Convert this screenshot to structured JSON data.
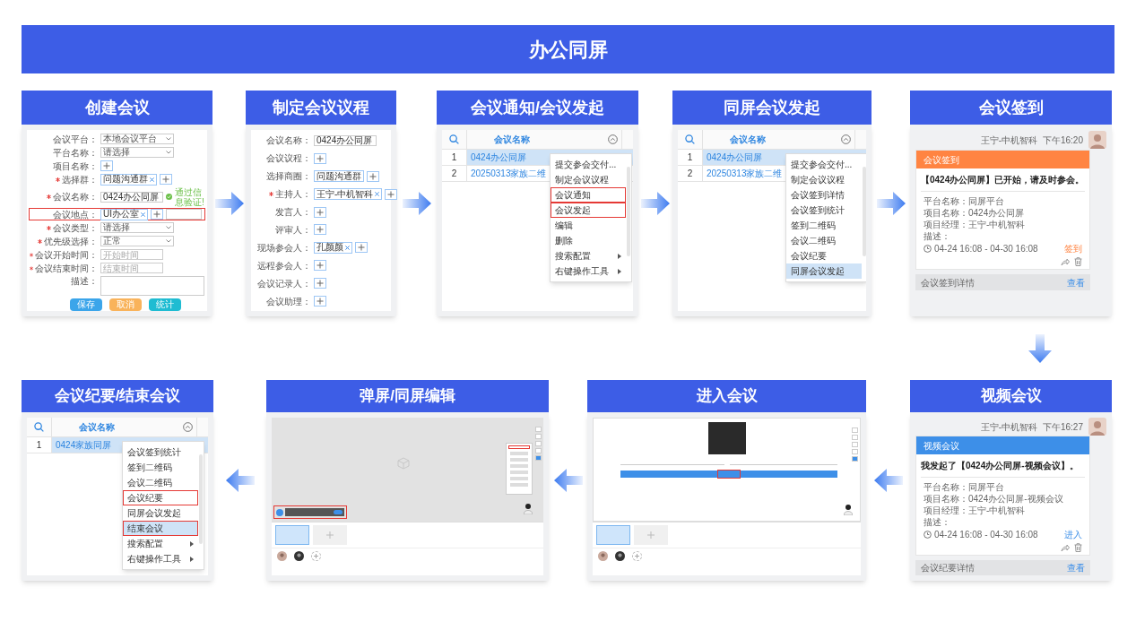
{
  "title": "办公同屏",
  "top_row": [
    {
      "title": "创建会议",
      "kind": "form",
      "fields": [
        {
          "label": "会议平台：",
          "required": false,
          "highlighted": false,
          "kind": "select",
          "value": "本地会议平台"
        },
        {
          "label": "平台名称：",
          "required": false,
          "highlighted": false,
          "kind": "select",
          "value": "请选择"
        },
        {
          "label": "项目名称：",
          "required": false,
          "highlighted": false,
          "kind": "add"
        },
        {
          "label": "选择群：",
          "required": true,
          "highlighted": false,
          "kind": "tags",
          "tags": [
            {
              "text": "问题沟通群",
              "removable": true
            }
          ]
        },
        {
          "label": "会议名称：",
          "required": true,
          "highlighted": false,
          "kind": "input",
          "value": "0424办公同屏",
          "hint": "通过信息验证!"
        },
        {
          "label": "会议地点：",
          "required": false,
          "highlighted": true,
          "kind": "tags_input",
          "tags": [
            {
              "text": "UI办公室",
              "removable": true
            }
          ]
        },
        {
          "label": "会议类型：",
          "required": true,
          "highlighted": false,
          "kind": "select",
          "value": "请选择"
        },
        {
          "label": "优先级选择：",
          "required": true,
          "highlighted": false,
          "kind": "select",
          "value": "正常"
        },
        {
          "label": "会议开始时间：",
          "required": true,
          "highlighted": false,
          "kind": "input",
          "placeholder": "开始时间"
        },
        {
          "label": "会议结束时间：",
          "required": true,
          "highlighted": false,
          "kind": "input",
          "placeholder": "结束时间"
        },
        {
          "label": "描述：",
          "required": false,
          "highlighted": false,
          "kind": "textarea"
        }
      ],
      "buttons": [
        {
          "label": "保存",
          "color": "#3ba5ea"
        },
        {
          "label": "取消",
          "color": "#f9b35b"
        },
        {
          "label": "统计",
          "color": "#1fbcd2"
        }
      ]
    },
    {
      "title": "制定会议议程",
      "kind": "form",
      "fields": [
        {
          "label": "会议名称：",
          "required": false,
          "highlighted": false,
          "kind": "input",
          "value": "0424办公同屏"
        },
        {
          "label": "会议议程：",
          "required": false,
          "highlighted": false,
          "kind": "add"
        },
        {
          "label": "选择商圈：",
          "required": false,
          "highlighted": false,
          "kind": "tags",
          "tags": [
            {
              "text": "问题沟通群",
              "removable": false
            }
          ]
        },
        {
          "label": "主持人：",
          "required": true,
          "highlighted": false,
          "kind": "tags",
          "tags": [
            {
              "text": "王宁-中机智科",
              "removable": true
            }
          ]
        },
        {
          "label": "发言人：",
          "required": false,
          "highlighted": false,
          "kind": "add"
        },
        {
          "label": "评审人：",
          "required": false,
          "highlighted": false,
          "kind": "add"
        },
        {
          "label": "现场参会人：",
          "required": false,
          "highlighted": false,
          "kind": "tags",
          "tags": [
            {
              "text": "孔颜颜",
              "removable": true
            }
          ]
        },
        {
          "label": "远程参会人：",
          "required": false,
          "highlighted": false,
          "kind": "add"
        },
        {
          "label": "会议记录人：",
          "required": false,
          "highlighted": false,
          "kind": "add"
        },
        {
          "label": "会议助理：",
          "required": false,
          "highlighted": false,
          "kind": "add"
        }
      ]
    },
    {
      "title": "会议通知/会议发起",
      "kind": "table_menu",
      "column": "会议名称",
      "rows": [
        {
          "number": "1",
          "name": "0424办公同屏",
          "selected": true
        },
        {
          "number": "2",
          "name": "20250313家族二维",
          "selected": false
        }
      ],
      "menu": [
        {
          "text": "提交参会交付...",
          "submenu": false,
          "highlighted": false,
          "selected": false
        },
        {
          "text": "制定会议议程",
          "submenu": false,
          "highlighted": false,
          "selected": false
        },
        {
          "text": "会议通知",
          "submenu": false,
          "highlighted": true,
          "selected": false
        },
        {
          "text": "会议发起",
          "submenu": false,
          "highlighted": true,
          "selected": false
        },
        {
          "text": "编辑",
          "submenu": false,
          "highlighted": false,
          "selected": false
        },
        {
          "text": "删除",
          "submenu": false,
          "highlighted": false,
          "selected": false
        },
        {
          "text": "搜索配置",
          "submenu": true,
          "highlighted": false,
          "selected": false
        },
        {
          "text": "右键操作工具",
          "submenu": true,
          "highlighted": false,
          "selected": false
        }
      ]
    },
    {
      "title": "同屏会议发起",
      "kind": "table_menu",
      "column": "会议名称",
      "rows": [
        {
          "number": "1",
          "name": "0424办公同屏",
          "selected": true
        },
        {
          "number": "2",
          "name": "20250313家族二维",
          "selected": false
        }
      ],
      "menu": [
        {
          "text": "提交参会交付...",
          "submenu": false,
          "highlighted": false,
          "selected": false
        },
        {
          "text": "制定会议议程",
          "submenu": false,
          "highlighted": false,
          "selected": false
        },
        {
          "text": "会议签到详情",
          "submenu": false,
          "highlighted": false,
          "selected": false
        },
        {
          "text": "会议签到统计",
          "submenu": false,
          "highlighted": false,
          "selected": false
        },
        {
          "text": "签到二维码",
          "submenu": false,
          "highlighted": false,
          "selected": false
        },
        {
          "text": "会议二维码",
          "submenu": false,
          "highlighted": false,
          "selected": false
        },
        {
          "text": "会议纪要",
          "submenu": false,
          "highlighted": false,
          "selected": false
        },
        {
          "text": "同屏会议发起",
          "submenu": false,
          "highlighted": false,
          "selected": true
        }
      ]
    },
    {
      "title": "会议签到",
      "kind": "chat_card",
      "sender": "王宁-中机智科",
      "time": "下午16:20",
      "card_title": "会议签到",
      "color": "#ff8442",
      "message": "【0424办公同屏】已开始，请及时参会。",
      "details": [
        "平台名称：同屏平台",
        "项目名称：0424办公同屏",
        "项目经理：王宁-中机智科",
        "描述："
      ],
      "period": "04-24 16:08 - 04-30 16:08",
      "action": "签到",
      "footer": "会议签到详情",
      "footer_link": "查看"
    }
  ],
  "bottom_row": [
    {
      "title": "会议纪要/结束会议",
      "kind": "table_menu",
      "column": "会议名称",
      "rows": [
        {
          "number": "1",
          "name": "0424家族同屏",
          "selected": true
        }
      ],
      "menu": [
        {
          "text": "会议签到统计",
          "submenu": false,
          "highlighted": false,
          "selected": false
        },
        {
          "text": "签到二维码",
          "submenu": false,
          "highlighted": false,
          "selected": false
        },
        {
          "text": "会议二维码",
          "submenu": false,
          "highlighted": false,
          "selected": false
        },
        {
          "text": "会议纪要",
          "submenu": false,
          "highlighted": true,
          "selected": false
        },
        {
          "text": "同屏会议发起",
          "submenu": false,
          "highlighted": false,
          "selected": false
        },
        {
          "text": "结束会议",
          "submenu": false,
          "highlighted": true,
          "selected": true
        },
        {
          "text": "搜索配置",
          "submenu": true,
          "highlighted": false,
          "selected": false
        },
        {
          "text": "右键操作工具",
          "submenu": true,
          "highlighted": false,
          "selected": false
        }
      ]
    },
    {
      "title": "弹屏/同屏编辑",
      "kind": "screen_edit"
    },
    {
      "title": "进入会议",
      "kind": "screen_join"
    },
    {
      "title": "视频会议",
      "kind": "chat_card",
      "sender": "王宁-中机智科",
      "time": "下午16:27",
      "card_title": "视频会议",
      "color": "#3d8fe8",
      "message": "我发起了【0424办公同屏-视频会议】。",
      "details": [
        "平台名称：同屏平台",
        "项目名称：0424办公同屏-视频会议",
        "项目经理：王宁-中机智科",
        "描述："
      ],
      "period": "04-24 16:08 - 04-30 16:08",
      "action": "进入",
      "footer": "会议纪要详情",
      "footer_link": "查看"
    }
  ]
}
